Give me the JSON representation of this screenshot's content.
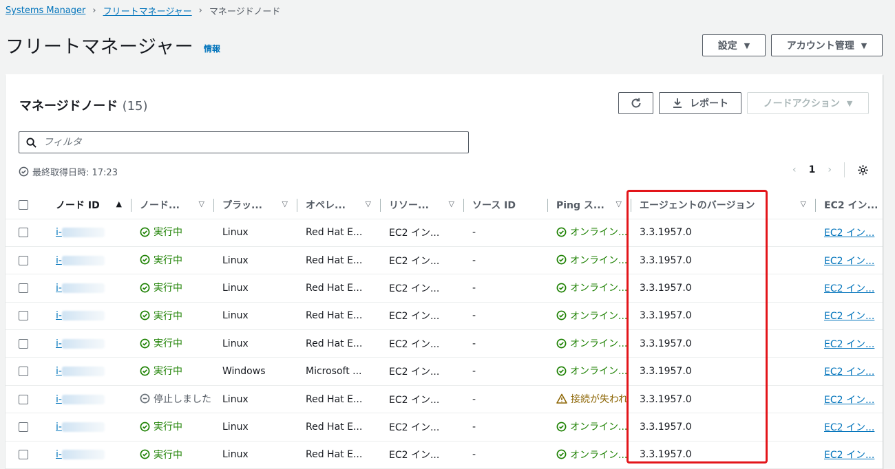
{
  "breadcrumb": {
    "items": [
      "Systems Manager",
      "フリートマネージャー"
    ],
    "current": "マネージドノード"
  },
  "page": {
    "title": "フリートマネージャー",
    "info_label": "情報"
  },
  "header_buttons": {
    "settings": "設定",
    "account_management": "アカウント管理"
  },
  "panel": {
    "title": "マネージドノード",
    "count": "(15)",
    "report_button": "レポート",
    "node_action_button": "ノードアクション",
    "filter_placeholder": "フィルタ",
    "last_fetched": "最終取得日時: 17:23",
    "page_number": "1"
  },
  "table": {
    "columns": [
      "ノード ID",
      "ノード...",
      "プラッ...",
      "オペレ...",
      "リソー...",
      "ソース ID",
      "Ping ス...",
      "エージェントのバージョン",
      "EC2 イン..."
    ],
    "rows": [
      {
        "id_prefix": "i-",
        "status": "実行中",
        "status_type": "ok",
        "platform": "Linux",
        "os": "Red Hat E...",
        "resource": "EC2 イン...",
        "source_id": "-",
        "ping": "オンライン...",
        "ping_type": "ok",
        "agent": "3.3.1957.0",
        "ec2": "EC2 イン..."
      },
      {
        "id_prefix": "i-",
        "status": "実行中",
        "status_type": "ok",
        "platform": "Linux",
        "os": "Red Hat E...",
        "resource": "EC2 イン...",
        "source_id": "-",
        "ping": "オンライン...",
        "ping_type": "ok",
        "agent": "3.3.1957.0",
        "ec2": "EC2 イン..."
      },
      {
        "id_prefix": "i-",
        "status": "実行中",
        "status_type": "ok",
        "platform": "Linux",
        "os": "Red Hat E...",
        "resource": "EC2 イン...",
        "source_id": "-",
        "ping": "オンライン...",
        "ping_type": "ok",
        "agent": "3.3.1957.0",
        "ec2": "EC2 イン..."
      },
      {
        "id_prefix": "i-",
        "status": "実行中",
        "status_type": "ok",
        "platform": "Linux",
        "os": "Red Hat E...",
        "resource": "EC2 イン...",
        "source_id": "-",
        "ping": "オンライン...",
        "ping_type": "ok",
        "agent": "3.3.1957.0",
        "ec2": "EC2 イン..."
      },
      {
        "id_prefix": "i-",
        "status": "実行中",
        "status_type": "ok",
        "platform": "Linux",
        "os": "Red Hat E...",
        "resource": "EC2 イン...",
        "source_id": "-",
        "ping": "オンライン...",
        "ping_type": "ok",
        "agent": "3.3.1957.0",
        "ec2": "EC2 イン..."
      },
      {
        "id_prefix": "i-",
        "status": "実行中",
        "status_type": "ok",
        "platform": "Windows",
        "os": "Microsoft ...",
        "resource": "EC2 イン...",
        "source_id": "-",
        "ping": "オンライン...",
        "ping_type": "ok",
        "agent": "3.3.1957.0",
        "ec2": "EC2 イン..."
      },
      {
        "id_prefix": "i-",
        "status": "停止しました",
        "status_type": "stopped",
        "platform": "Linux",
        "os": "Red Hat E...",
        "resource": "EC2 イン...",
        "source_id": "-",
        "ping": "接続が失われ",
        "ping_type": "warn",
        "agent": "3.3.1957.0",
        "ec2": "EC2 イン..."
      },
      {
        "id_prefix": "i-",
        "status": "実行中",
        "status_type": "ok",
        "platform": "Linux",
        "os": "Red Hat E...",
        "resource": "EC2 イン...",
        "source_id": "-",
        "ping": "オンライン...",
        "ping_type": "ok",
        "agent": "3.3.1957.0",
        "ec2": "EC2 イン..."
      },
      {
        "id_prefix": "i-",
        "status": "実行中",
        "status_type": "ok",
        "platform": "Linux",
        "os": "Red Hat E...",
        "resource": "EC2 イン...",
        "source_id": "-",
        "ping": "オンライン...",
        "ping_type": "ok",
        "agent": "3.3.1957.0",
        "ec2": "EC2 イン..."
      }
    ]
  },
  "colors": {
    "link": "#0073bb",
    "ok": "#1d8102",
    "warn": "#8d6605",
    "highlight": "#e3151a"
  }
}
